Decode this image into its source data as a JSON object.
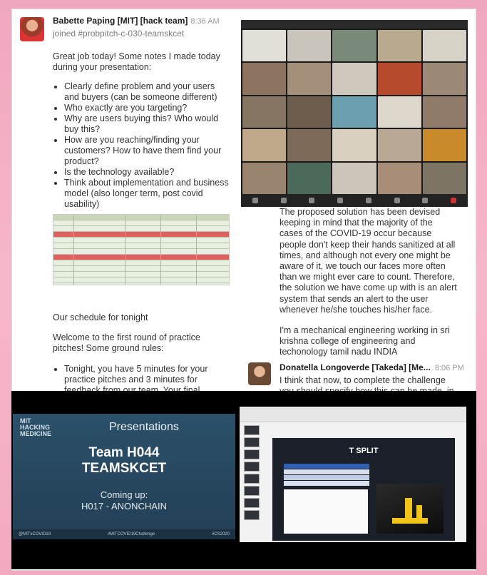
{
  "left_message": {
    "author": "Babette Paping [MIT] [hack team]",
    "time": "8:36 AM",
    "joined": "joined #probpitch-c-030-teamskcet",
    "intro": "Great job today! Some notes I made today during your presentation:",
    "bullets": [
      "Clearly define problem and your users and buyers (can be someone different)",
      "Who exactly are you targeting?",
      "Why are users buying this? Who would buy this?",
      "How are you reaching/finding your customers? How to have them find your product?",
      "Is the technology available?",
      "Think about implementation and business model (also longer term, post covid usability)"
    ],
    "image_caption": "Our schedule for tonight",
    "welcome": "Welcome to the first round of practice pitches! Some ground rules:",
    "rule_1": "Tonight, you have 5 minutes for your practice pitches and 3 minutes for feedback from our team. Your final pitches"
  },
  "right_message": {
    "para_1": "The proposed solution has been devised keeping in mind that the majority of the cases of the COVID-19 occur because people don't keep their hands sanitized at all times, and although not every one might be aware of it, we touch our faces more often than we might ever care to count. Therefore, the solution we have come up with is an alert system that sends an alert to the user whenever he/she touches his/her face.",
    "para_2": "I'm a mechanical engineering working in sri krishna college of engineering and techonology tamil nadu INDIA",
    "author_2": "Donatella Longoverde [Takeda] [Me...",
    "time_2": "8:06 PM",
    "text_2": "I think that now, to complete the challenge you should specify how this can be made, in"
  },
  "slide": {
    "logo_line1": "MIT",
    "logo_line2": "HACKING",
    "logo_line3": "MEDICINE",
    "heading": "Presentations",
    "team_line1": "Team H044",
    "team_line2": "TEAMSKCET",
    "coming_label": "Coming up:",
    "next_team": "H017 - ANONCHAIN",
    "footer_1": "@MITxCOVID19",
    "footer_2": "#MITCOVID19Challenge",
    "footer_3": "#CS2020"
  },
  "screen_share": {
    "slide_title": "T SPLIT"
  },
  "colors": {
    "background": "#f4afc4",
    "slide_bg": "#264860",
    "accent_yellow": "#f0c419"
  }
}
